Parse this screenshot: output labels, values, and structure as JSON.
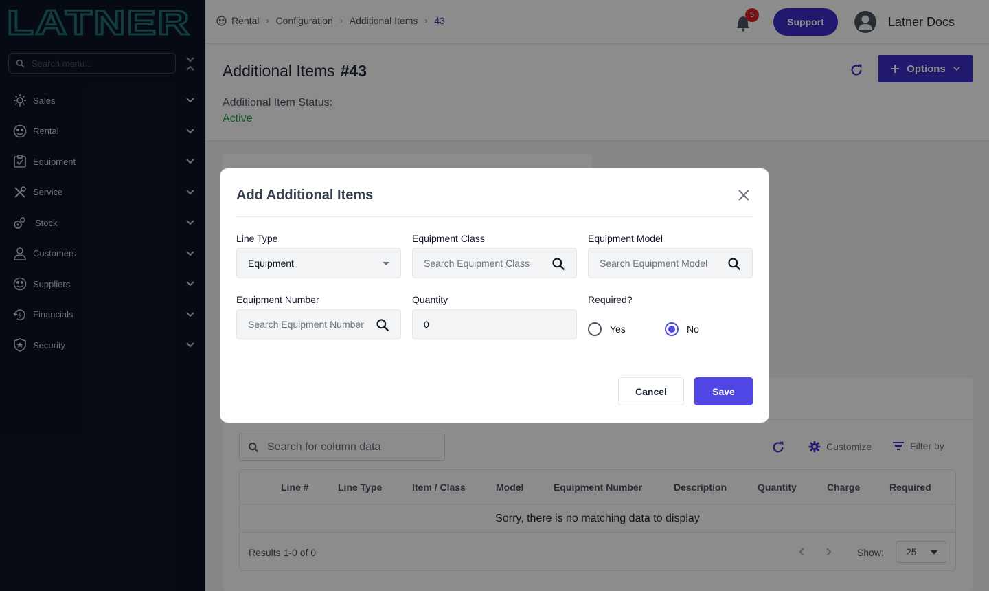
{
  "app": {
    "logo_text": "LATNER"
  },
  "sidebar": {
    "search_placeholder": "Search menu...",
    "items": [
      {
        "label": "Sales",
        "icon": "sales-icon"
      },
      {
        "label": "Rental",
        "icon": "rental-icon"
      },
      {
        "label": "Equipment",
        "icon": "equipment-icon"
      },
      {
        "label": "Service",
        "icon": "service-icon"
      },
      {
        "label": "Stock",
        "icon": "stock-icon"
      },
      {
        "label": "Customers",
        "icon": "customers-icon"
      },
      {
        "label": "Suppliers",
        "icon": "suppliers-icon"
      },
      {
        "label": "Financials",
        "icon": "financials-icon"
      },
      {
        "label": "Security",
        "icon": "security-icon"
      }
    ]
  },
  "topbar": {
    "breadcrumb": [
      "Rental",
      "Configuration",
      "Additional Items",
      "43"
    ],
    "notification_count": "5",
    "support_label": "Support",
    "user_name": "Latner Docs"
  },
  "page": {
    "title": "Additional Items",
    "number": "#43",
    "status_label": "Additional Item Status:",
    "status_value": "Active",
    "options_label": "Options"
  },
  "table": {
    "search_placeholder": "Search for column data",
    "customize_label": "Customize",
    "filter_label": "Filter by",
    "columns": [
      "Line #",
      "Line Type",
      "Item / Class",
      "Model",
      "Equipment Number",
      "Description",
      "Quantity",
      "Charge",
      "Required"
    ],
    "empty_message": "Sorry, there is no matching data to display",
    "results_text": "Results 1-0 of 0",
    "show_label": "Show:",
    "page_size": "25"
  },
  "modal": {
    "title": "Add Additional Items",
    "line_type": {
      "label": "Line Type",
      "value": "Equipment"
    },
    "equipment_class": {
      "label": "Equipment Class",
      "placeholder": "Search Equipment Class"
    },
    "equipment_model": {
      "label": "Equipment Model",
      "placeholder": "Search Equipment Model"
    },
    "equipment_number": {
      "label": "Equipment Number",
      "placeholder": "Search Equipment Number"
    },
    "quantity": {
      "label": "Quantity",
      "value": "0"
    },
    "required": {
      "label": "Required?",
      "yes_label": "Yes",
      "no_label": "No",
      "selected": "No"
    },
    "cancel_label": "Cancel",
    "save_label": "Save"
  },
  "colors": {
    "sidebar_bg": "#0b1424",
    "primary": "#3b2fc9",
    "save": "#4f46e5",
    "status_active": "#16a34a",
    "badge": "#dc2626"
  }
}
